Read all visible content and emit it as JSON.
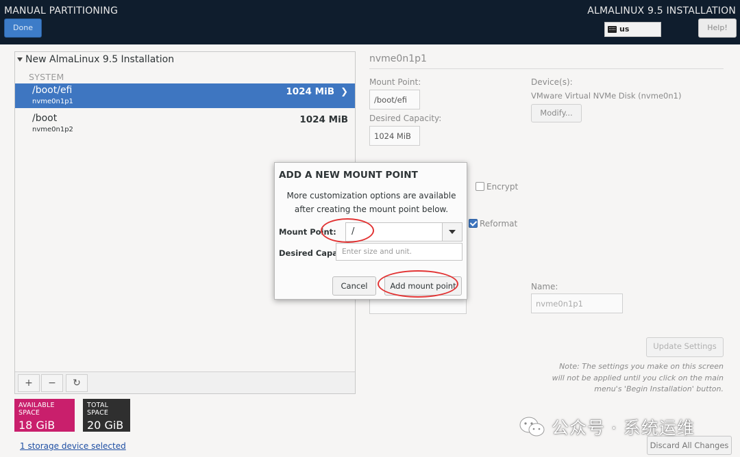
{
  "header": {
    "title": "MANUAL PARTITIONING",
    "product": "ALMALINUX 9.5 INSTALLATION",
    "done_label": "Done",
    "keyboard_layout": "us",
    "help_label": "Help!"
  },
  "left_pane": {
    "installation_title": "New AlmaLinux 9.5 Installation",
    "section_label": "SYSTEM",
    "partitions": [
      {
        "mount_point": "/boot/efi",
        "device": "nvme0n1p1",
        "size": "1024 MiB",
        "selected": true
      },
      {
        "mount_point": "/boot",
        "device": "nvme0n1p2",
        "size": "1024 MiB",
        "selected": false
      }
    ],
    "toolbar": {
      "add": "+",
      "remove": "−",
      "refresh": "↻"
    },
    "available_space": {
      "label": "AVAILABLE SPACE",
      "value": "18 GiB"
    },
    "total_space": {
      "label": "TOTAL SPACE",
      "value": "20 GiB"
    },
    "storage_link": "1 storage device selected"
  },
  "right_pane": {
    "title": "nvme0n1p1",
    "mount_point_label": "Mount Point:",
    "mount_point_value": "/boot/efi",
    "desired_capacity_label": "Desired Capacity:",
    "desired_capacity_value": "1024 MiB",
    "devices_label": "Device(s):",
    "device_name": "VMware Virtual NVMe Disk (nvme0n1)",
    "modify_label": "Modify...",
    "encrypt_label": "Encrypt",
    "reformat_label": "Reformat",
    "name_label": "Name:",
    "name_value": "nvme0n1p1",
    "update_label": "Update Settings",
    "note": "Note:  The settings you make on this screen will not be applied until you click on the main menu's 'Begin Installation' button.",
    "discard_label": "Discard All Changes"
  },
  "dialog": {
    "title": "ADD A NEW MOUNT POINT",
    "description_line1": "More customization options are available",
    "description_line2": "after creating the mount point below.",
    "mount_point_label": "Mount Point:",
    "mount_point_value": "/",
    "desired_capacity_label": "Desired Capacity:",
    "desired_capacity_placeholder": "Enter size and unit.",
    "cancel_label": "Cancel",
    "add_label": "Add mount point"
  },
  "watermark": {
    "text": "公众号 · 系统运维"
  },
  "colors": {
    "header_bg": "#0f1d2d",
    "selection": "#3e76c1",
    "available_space": "#c91f6c",
    "total_space": "#2f2f2f",
    "annotation": "#e23333"
  }
}
